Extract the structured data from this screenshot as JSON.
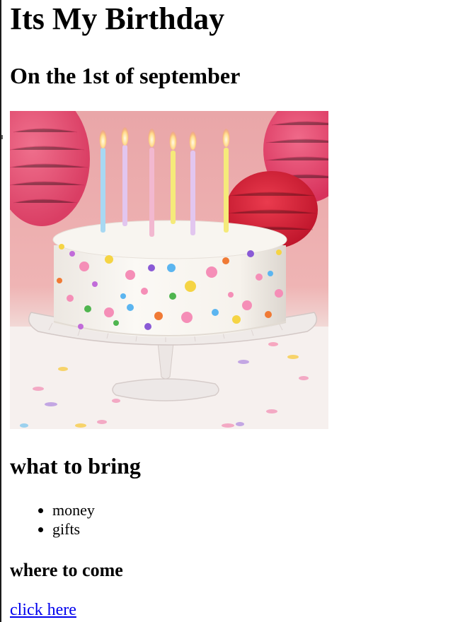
{
  "page": {
    "title": "Its My Birthday",
    "date_heading": "On the 1st of september",
    "bring_heading": "what to bring",
    "items": [
      "money",
      "gifts"
    ],
    "location_heading": "where to come",
    "link_text": "click here"
  },
  "image": {
    "icon": "birthday-cake-photo",
    "colors": {
      "background": "#eba5a7",
      "frosting": "#fbf8f3",
      "pink_lantern": "#e8436b",
      "red_lantern": "#d8223a",
      "glass_stand": "#ece8e6",
      "table": "#f6f1ef"
    }
  }
}
